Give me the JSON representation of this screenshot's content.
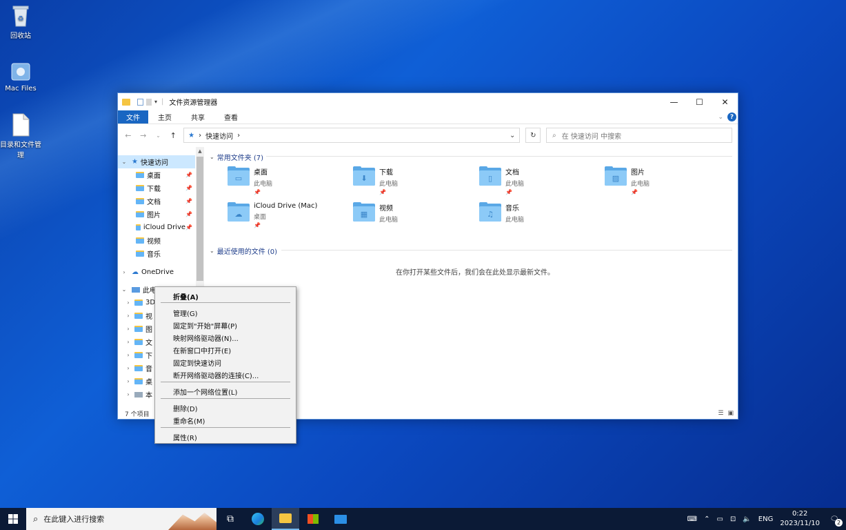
{
  "desktop": {
    "icons": [
      {
        "label": "回收站",
        "icon": "recycle-bin-icon"
      },
      {
        "label": "Mac Files",
        "icon": "mac-drive-icon"
      },
      {
        "label": "目录和文件管理",
        "icon": "document-icon"
      }
    ]
  },
  "explorer": {
    "title": "文件资源管理器",
    "ribbon_tabs": [
      "文件",
      "主页",
      "共享",
      "查看"
    ],
    "address": {
      "segment": "快速访问"
    },
    "search_placeholder": "在 快速访问 中搜索",
    "nav": {
      "quick_access": "快速访问",
      "quick_items": [
        "桌面",
        "下载",
        "文档",
        "图片",
        "iCloud Drive",
        "视频",
        "音乐"
      ],
      "onedrive": "OneDrive",
      "this_pc": "此电脑",
      "pc_items": [
        "3D",
        "视",
        "图",
        "文",
        "下",
        "音",
        "桌",
        "本"
      ]
    },
    "frequent_header": "常用文件夹 (7)",
    "folders": [
      {
        "name": "桌面",
        "loc": "此电脑",
        "pinned": true,
        "glyph": "▭"
      },
      {
        "name": "下载",
        "loc": "此电脑",
        "pinned": true,
        "glyph": "⬇"
      },
      {
        "name": "文档",
        "loc": "此电脑",
        "pinned": true,
        "glyph": "▯"
      },
      {
        "name": "图片",
        "loc": "此电脑",
        "pinned": true,
        "glyph": "▨"
      },
      {
        "name": "iCloud Drive (Mac)",
        "loc": "桌面",
        "pinned": true,
        "glyph": "☁"
      },
      {
        "name": "视频",
        "loc": "此电脑",
        "pinned": false,
        "glyph": "▦"
      },
      {
        "name": "音乐",
        "loc": "此电脑",
        "pinned": false,
        "glyph": "♫"
      }
    ],
    "recent_header": "最近使用的文件 (0)",
    "empty_message": "在你打开某些文件后，我们会在此处显示最新文件。",
    "status": "7 个项目"
  },
  "context_menu": {
    "items": [
      "折叠(A)",
      "管理(G)",
      "固定到\"开始\"屏幕(P)",
      "映射网络驱动器(N)...",
      "在新窗口中打开(E)",
      "固定到快速访问",
      "断开网络驱动器的连接(C)...",
      "添加一个网络位置(L)",
      "删除(D)",
      "重命名(M)",
      "属性(R)"
    ]
  },
  "taskbar": {
    "search_placeholder": "在此键入进行搜索",
    "lang": "ENG",
    "time": "0:22",
    "date": "2023/11/10",
    "notifications": "2"
  },
  "colors": {
    "accent": "#1966c2",
    "folder": "#5aa8e6",
    "desktop": "#0f5fd6"
  }
}
